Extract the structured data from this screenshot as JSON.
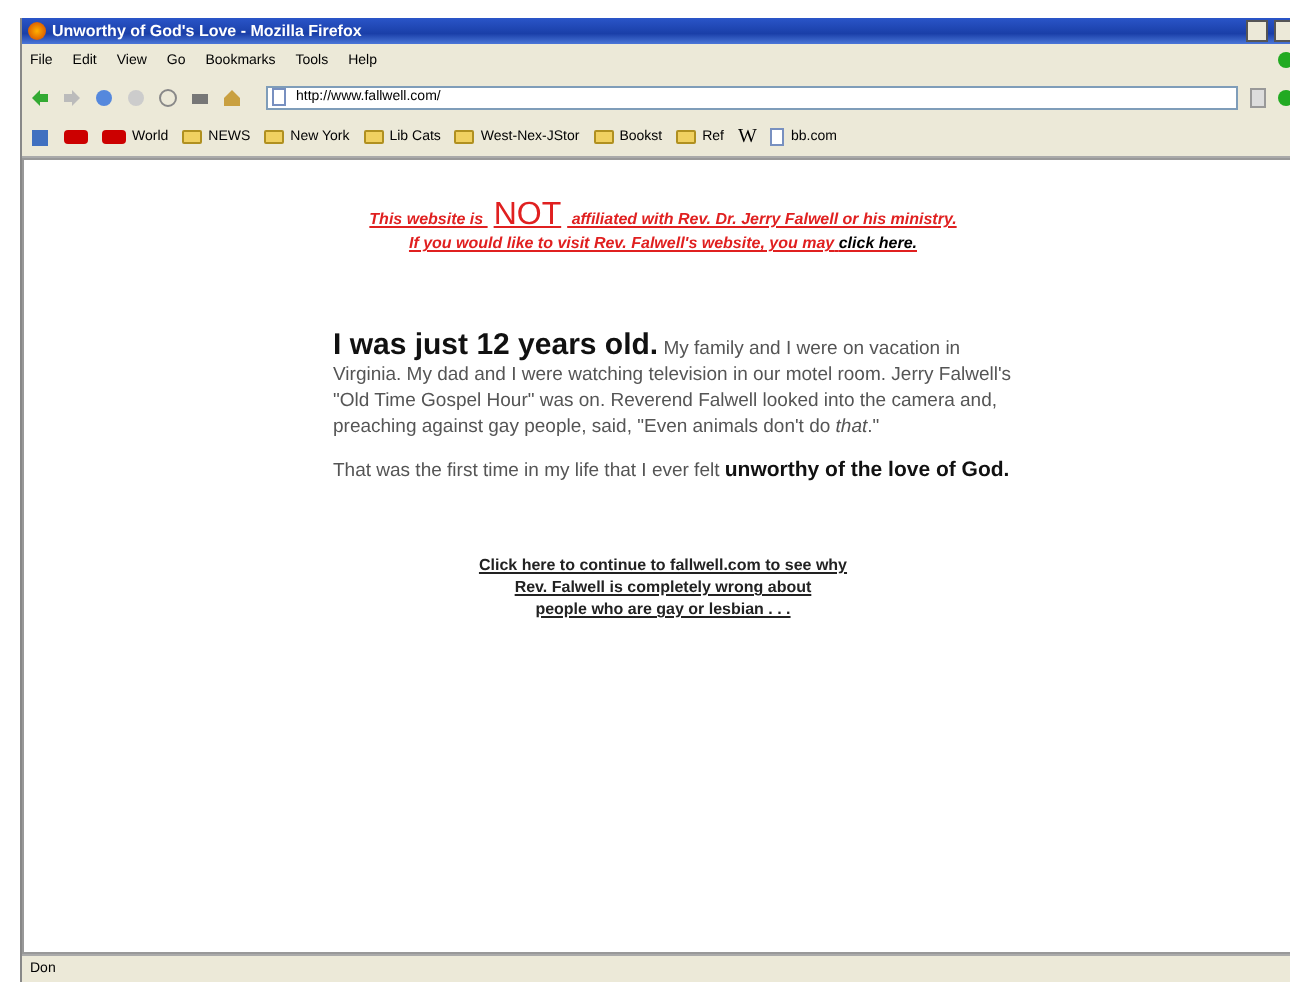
{
  "window": {
    "title": "Unworthy of God's Love - Mozilla Firefox"
  },
  "menu": [
    "File",
    "Edit",
    "View",
    "Go",
    "Bookmarks",
    "Tools",
    "Help"
  ],
  "address_bar": {
    "value": "http://www.fallwell.com/"
  },
  "bookmarks": [
    {
      "kind": "icon"
    },
    {
      "kind": "text",
      "label": "World"
    },
    {
      "kind": "folder",
      "label": "NEWS"
    },
    {
      "kind": "folder",
      "label": "New York"
    },
    {
      "kind": "folder",
      "label": "Lib Cats"
    },
    {
      "kind": "folder",
      "label": "West-Nex-JStor"
    },
    {
      "kind": "folder",
      "label": "Bookst"
    },
    {
      "kind": "folder",
      "label": "Ref"
    },
    {
      "kind": "wiki",
      "label": "W"
    },
    {
      "kind": "page",
      "label": "bb.com"
    }
  ],
  "page": {
    "disclaimer_line_1": "This website is **NOT** affiliated with Rev. Dr. Jerry Falwell or his ministry.",
    "disclaimer_line_2": "If you would like to visit Rev. Falwell's website, you may",
    "disclaimer_link": "click here.",
    "story": "**I was just 12 years old.** My family and I were on vacation in Virginia. My dad and I were watching television in our motel room. Jerry Falwell's \"Old Time Gospel Hour\" was on. Reverend Falwell looked into the camera and, preaching against gay people, said, \"Even animals don't do *that*.\"",
    "story_2": "That was the first time in my life that I ever felt **unworthy of the love of God.**",
    "continue_link": [
      "Click here to continue to fallwell.com to see why",
      "Rev. Falwell is completely wrong about",
      "people who are gay or lesbian . . ."
    ]
  },
  "status_bar": {
    "text": "Don"
  }
}
